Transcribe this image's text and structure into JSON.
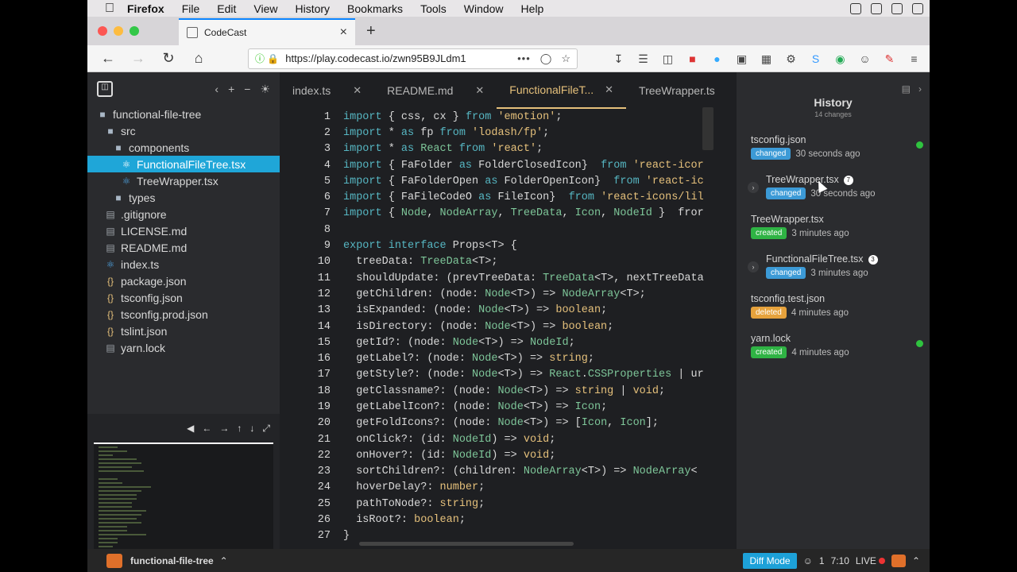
{
  "menubar": {
    "app": "Firefox",
    "items": [
      "File",
      "Edit",
      "View",
      "History",
      "Bookmarks",
      "Tools",
      "Window",
      "Help"
    ]
  },
  "browser": {
    "tab_title": "CodeCast",
    "url": "https://play.codecast.io/zwn95B9JLdm1"
  },
  "sidebar": {
    "items": [
      {
        "label": "functional-file-tree",
        "type": "folder",
        "indent": 0
      },
      {
        "label": "src",
        "type": "folder",
        "indent": 1
      },
      {
        "label": "components",
        "type": "folder",
        "indent": 2
      },
      {
        "label": "FunctionalFileTree.tsx",
        "type": "ts",
        "indent": 3,
        "active": true
      },
      {
        "label": "TreeWrapper.tsx",
        "type": "ts",
        "indent": 3
      },
      {
        "label": "types",
        "type": "folder",
        "indent": 2
      },
      {
        "label": ".gitignore",
        "type": "doc",
        "indent": 1
      },
      {
        "label": "LICENSE.md",
        "type": "doc",
        "indent": 1
      },
      {
        "label": "README.md",
        "type": "doc",
        "indent": 1
      },
      {
        "label": "index.ts",
        "type": "ts",
        "indent": 1
      },
      {
        "label": "package.json",
        "type": "json",
        "indent": 1
      },
      {
        "label": "tsconfig.json",
        "type": "json",
        "indent": 1
      },
      {
        "label": "tsconfig.prod.json",
        "type": "json",
        "indent": 1
      },
      {
        "label": "tslint.json",
        "type": "json",
        "indent": 1
      },
      {
        "label": "yarn.lock",
        "type": "doc",
        "indent": 1
      }
    ]
  },
  "editor": {
    "tabs": [
      {
        "label": "index.ts",
        "active": false
      },
      {
        "label": "README.md",
        "active": false
      },
      {
        "label": "FunctionalFileT...",
        "active": true
      },
      {
        "label": "TreeWrapper.ts",
        "active": false
      }
    ],
    "lines": [
      "import { css, cx } from 'emotion';",
      "import * as fp from 'lodash/fp';",
      "import * as React from 'react';",
      "import { FaFolder as FolderClosedIcon}  from 'react-icor",
      "import { FaFolderOpen as FolderOpenIcon}  from 'react-ic",
      "import { FaFileCodeO as FileIcon}  from 'react-icons/lil",
      "import { Node, NodeArray, TreeData, Icon, NodeId }  fror",
      "",
      "export interface Props<T> {",
      "  treeData: TreeData<T>;",
      "  shouldUpdate: (prevTreeData: TreeData<T>, nextTreeData",
      "  getChildren: (node: Node<T>) => NodeArray<T>;",
      "  isExpanded: (node: Node<T>) => boolean;",
      "  isDirectory: (node: Node<T>) => boolean;",
      "  getId?: (node: Node<T>) => NodeId;",
      "  getLabel?: (node: Node<T>) => string;",
      "  getStyle?: (node: Node<T>) => React.CSSProperties | ur",
      "  getClassname?: (node: Node<T>) => string | void;",
      "  getLabelIcon?: (node: Node<T>) => Icon;",
      "  getFoldIcons?: (node: Node<T>) => [Icon, Icon];",
      "  onClick?: (id: NodeId) => void;",
      "  onHover?: (id: NodeId) => void;",
      "  sortChildren?: (children: NodeArray<T>) => NodeArray<",
      "  hoverDelay?: number;",
      "  pathToNode?: string;",
      "  isRoot?: boolean;",
      "}",
      ""
    ]
  },
  "history": {
    "title": "History",
    "subtitle": "14 changes",
    "items": [
      {
        "name": "tsconfig.json",
        "status": "changed",
        "time": "30 seconds ago",
        "dot": true,
        "expandable": false
      },
      {
        "name": "TreeWrapper.tsx",
        "status": "changed",
        "time": "30 seconds ago",
        "count": "7",
        "dot": false,
        "expandable": true
      },
      {
        "name": "TreeWrapper.tsx",
        "status": "created",
        "time": "3 minutes ago",
        "dot": false,
        "expandable": false
      },
      {
        "name": "FunctionalFileTree.tsx",
        "status": "changed",
        "time": "3 minutes ago",
        "count": "3",
        "dot": false,
        "expandable": true
      },
      {
        "name": "tsconfig.test.json",
        "status": "deleted",
        "time": "4 minutes ago",
        "dot": false,
        "expandable": false
      },
      {
        "name": "yarn.lock",
        "status": "created",
        "time": "4 minutes ago",
        "dot": true,
        "expandable": false
      }
    ]
  },
  "dock": {
    "title": "functional-file-tree",
    "diff_mode": "Diff Mode",
    "viewers": "1",
    "time": "7:10",
    "live": "LIVE"
  },
  "colors": {
    "changed": "#3c9ad6",
    "created": "#2fb344",
    "deleted": "#e6a23c",
    "accent": "#1fa6d8"
  }
}
